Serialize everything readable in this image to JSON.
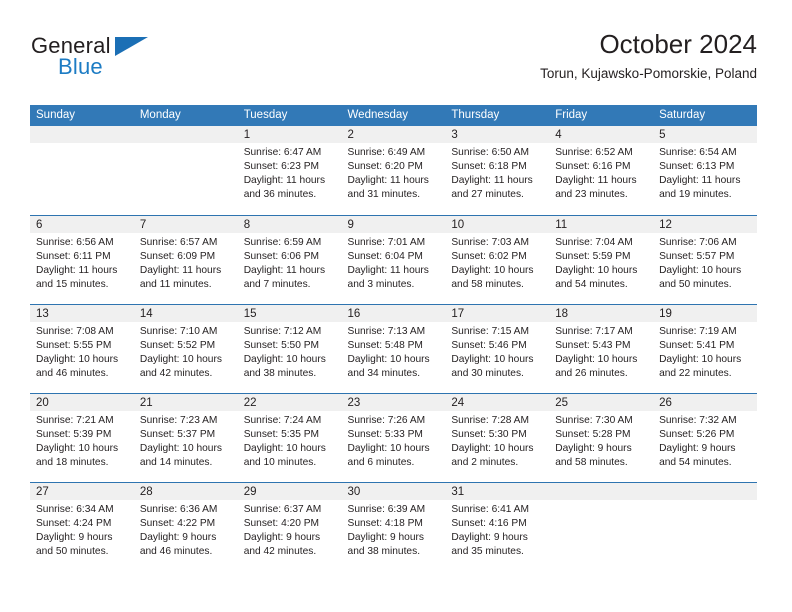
{
  "brand": {
    "name_part1": "General",
    "name_part2": "Blue",
    "logo_icon": "triangle-icon"
  },
  "header": {
    "month_title": "October 2024",
    "location": "Torun, Kujawsko-Pomorskie, Poland"
  },
  "calendar": {
    "weekday_headers": [
      "Sunday",
      "Monday",
      "Tuesday",
      "Wednesday",
      "Thursday",
      "Friday",
      "Saturday"
    ],
    "colors": {
      "header_blue": "#3279b7",
      "row_divider_blue": "#2e74b0",
      "daynum_band_gray": "#f0f0f0",
      "brand_blue": "#1d7cc4",
      "text": "#231f20"
    },
    "weeks": [
      [
        {
          "day": "",
          "sunrise": "",
          "sunset": "",
          "daylight_line1": "",
          "daylight_line2": ""
        },
        {
          "day": "",
          "sunrise": "",
          "sunset": "",
          "daylight_line1": "",
          "daylight_line2": ""
        },
        {
          "day": "1",
          "sunrise": "Sunrise: 6:47 AM",
          "sunset": "Sunset: 6:23 PM",
          "daylight_line1": "Daylight: 11 hours",
          "daylight_line2": "and 36 minutes."
        },
        {
          "day": "2",
          "sunrise": "Sunrise: 6:49 AM",
          "sunset": "Sunset: 6:20 PM",
          "daylight_line1": "Daylight: 11 hours",
          "daylight_line2": "and 31 minutes."
        },
        {
          "day": "3",
          "sunrise": "Sunrise: 6:50 AM",
          "sunset": "Sunset: 6:18 PM",
          "daylight_line1": "Daylight: 11 hours",
          "daylight_line2": "and 27 minutes."
        },
        {
          "day": "4",
          "sunrise": "Sunrise: 6:52 AM",
          "sunset": "Sunset: 6:16 PM",
          "daylight_line1": "Daylight: 11 hours",
          "daylight_line2": "and 23 minutes."
        },
        {
          "day": "5",
          "sunrise": "Sunrise: 6:54 AM",
          "sunset": "Sunset: 6:13 PM",
          "daylight_line1": "Daylight: 11 hours",
          "daylight_line2": "and 19 minutes."
        }
      ],
      [
        {
          "day": "6",
          "sunrise": "Sunrise: 6:56 AM",
          "sunset": "Sunset: 6:11 PM",
          "daylight_line1": "Daylight: 11 hours",
          "daylight_line2": "and 15 minutes."
        },
        {
          "day": "7",
          "sunrise": "Sunrise: 6:57 AM",
          "sunset": "Sunset: 6:09 PM",
          "daylight_line1": "Daylight: 11 hours",
          "daylight_line2": "and 11 minutes."
        },
        {
          "day": "8",
          "sunrise": "Sunrise: 6:59 AM",
          "sunset": "Sunset: 6:06 PM",
          "daylight_line1": "Daylight: 11 hours",
          "daylight_line2": "and 7 minutes."
        },
        {
          "day": "9",
          "sunrise": "Sunrise: 7:01 AM",
          "sunset": "Sunset: 6:04 PM",
          "daylight_line1": "Daylight: 11 hours",
          "daylight_line2": "and 3 minutes."
        },
        {
          "day": "10",
          "sunrise": "Sunrise: 7:03 AM",
          "sunset": "Sunset: 6:02 PM",
          "daylight_line1": "Daylight: 10 hours",
          "daylight_line2": "and 58 minutes."
        },
        {
          "day": "11",
          "sunrise": "Sunrise: 7:04 AM",
          "sunset": "Sunset: 5:59 PM",
          "daylight_line1": "Daylight: 10 hours",
          "daylight_line2": "and 54 minutes."
        },
        {
          "day": "12",
          "sunrise": "Sunrise: 7:06 AM",
          "sunset": "Sunset: 5:57 PM",
          "daylight_line1": "Daylight: 10 hours",
          "daylight_line2": "and 50 minutes."
        }
      ],
      [
        {
          "day": "13",
          "sunrise": "Sunrise: 7:08 AM",
          "sunset": "Sunset: 5:55 PM",
          "daylight_line1": "Daylight: 10 hours",
          "daylight_line2": "and 46 minutes."
        },
        {
          "day": "14",
          "sunrise": "Sunrise: 7:10 AM",
          "sunset": "Sunset: 5:52 PM",
          "daylight_line1": "Daylight: 10 hours",
          "daylight_line2": "and 42 minutes."
        },
        {
          "day": "15",
          "sunrise": "Sunrise: 7:12 AM",
          "sunset": "Sunset: 5:50 PM",
          "daylight_line1": "Daylight: 10 hours",
          "daylight_line2": "and 38 minutes."
        },
        {
          "day": "16",
          "sunrise": "Sunrise: 7:13 AM",
          "sunset": "Sunset: 5:48 PM",
          "daylight_line1": "Daylight: 10 hours",
          "daylight_line2": "and 34 minutes."
        },
        {
          "day": "17",
          "sunrise": "Sunrise: 7:15 AM",
          "sunset": "Sunset: 5:46 PM",
          "daylight_line1": "Daylight: 10 hours",
          "daylight_line2": "and 30 minutes."
        },
        {
          "day": "18",
          "sunrise": "Sunrise: 7:17 AM",
          "sunset": "Sunset: 5:43 PM",
          "daylight_line1": "Daylight: 10 hours",
          "daylight_line2": "and 26 minutes."
        },
        {
          "day": "19",
          "sunrise": "Sunrise: 7:19 AM",
          "sunset": "Sunset: 5:41 PM",
          "daylight_line1": "Daylight: 10 hours",
          "daylight_line2": "and 22 minutes."
        }
      ],
      [
        {
          "day": "20",
          "sunrise": "Sunrise: 7:21 AM",
          "sunset": "Sunset: 5:39 PM",
          "daylight_line1": "Daylight: 10 hours",
          "daylight_line2": "and 18 minutes."
        },
        {
          "day": "21",
          "sunrise": "Sunrise: 7:23 AM",
          "sunset": "Sunset: 5:37 PM",
          "daylight_line1": "Daylight: 10 hours",
          "daylight_line2": "and 14 minutes."
        },
        {
          "day": "22",
          "sunrise": "Sunrise: 7:24 AM",
          "sunset": "Sunset: 5:35 PM",
          "daylight_line1": "Daylight: 10 hours",
          "daylight_line2": "and 10 minutes."
        },
        {
          "day": "23",
          "sunrise": "Sunrise: 7:26 AM",
          "sunset": "Sunset: 5:33 PM",
          "daylight_line1": "Daylight: 10 hours",
          "daylight_line2": "and 6 minutes."
        },
        {
          "day": "24",
          "sunrise": "Sunrise: 7:28 AM",
          "sunset": "Sunset: 5:30 PM",
          "daylight_line1": "Daylight: 10 hours",
          "daylight_line2": "and 2 minutes."
        },
        {
          "day": "25",
          "sunrise": "Sunrise: 7:30 AM",
          "sunset": "Sunset: 5:28 PM",
          "daylight_line1": "Daylight: 9 hours",
          "daylight_line2": "and 58 minutes."
        },
        {
          "day": "26",
          "sunrise": "Sunrise: 7:32 AM",
          "sunset": "Sunset: 5:26 PM",
          "daylight_line1": "Daylight: 9 hours",
          "daylight_line2": "and 54 minutes."
        }
      ],
      [
        {
          "day": "27",
          "sunrise": "Sunrise: 6:34 AM",
          "sunset": "Sunset: 4:24 PM",
          "daylight_line1": "Daylight: 9 hours",
          "daylight_line2": "and 50 minutes."
        },
        {
          "day": "28",
          "sunrise": "Sunrise: 6:36 AM",
          "sunset": "Sunset: 4:22 PM",
          "daylight_line1": "Daylight: 9 hours",
          "daylight_line2": "and 46 minutes."
        },
        {
          "day": "29",
          "sunrise": "Sunrise: 6:37 AM",
          "sunset": "Sunset: 4:20 PM",
          "daylight_line1": "Daylight: 9 hours",
          "daylight_line2": "and 42 minutes."
        },
        {
          "day": "30",
          "sunrise": "Sunrise: 6:39 AM",
          "sunset": "Sunset: 4:18 PM",
          "daylight_line1": "Daylight: 9 hours",
          "daylight_line2": "and 38 minutes."
        },
        {
          "day": "31",
          "sunrise": "Sunrise: 6:41 AM",
          "sunset": "Sunset: 4:16 PM",
          "daylight_line1": "Daylight: 9 hours",
          "daylight_line2": "and 35 minutes."
        },
        {
          "day": "",
          "sunrise": "",
          "sunset": "",
          "daylight_line1": "",
          "daylight_line2": ""
        },
        {
          "day": "",
          "sunrise": "",
          "sunset": "",
          "daylight_line1": "",
          "daylight_line2": ""
        }
      ]
    ]
  }
}
